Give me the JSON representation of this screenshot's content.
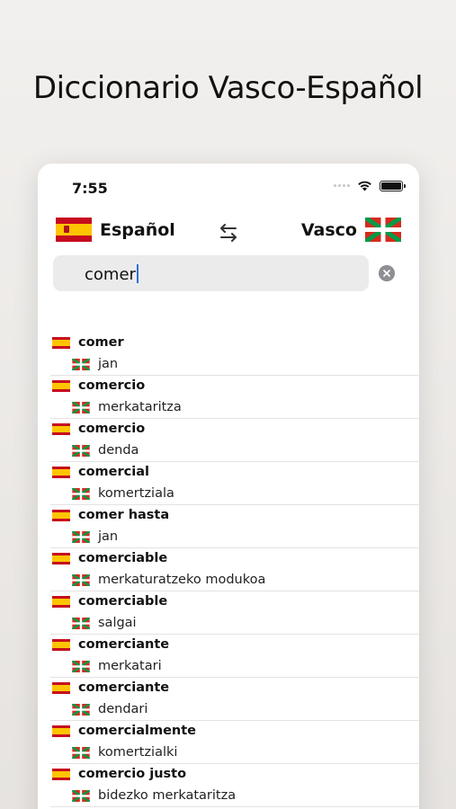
{
  "caption": "Diccionario Vasco-Español",
  "status_bar": {
    "time": "7:55"
  },
  "header": {
    "source_language": "Español",
    "target_language": "Vasco"
  },
  "search": {
    "value": "comer"
  },
  "results": [
    {
      "spanish": "comer",
      "basque": "jan"
    },
    {
      "spanish": "comercio",
      "basque": "merkataritza"
    },
    {
      "spanish": "comercio",
      "basque": "denda"
    },
    {
      "spanish": "comercial",
      "basque": "komertziala"
    },
    {
      "spanish": "comer hasta",
      "basque": "jan"
    },
    {
      "spanish": "comerciable",
      "basque": "merkaturatzeko modukoa"
    },
    {
      "spanish": "comerciable",
      "basque": "salgai"
    },
    {
      "spanish": "comerciante",
      "basque": "merkatari"
    },
    {
      "spanish": "comerciante",
      "basque": "dendari"
    },
    {
      "spanish": "comercialmente",
      "basque": "komertzialki"
    },
    {
      "spanish": "comercio justo",
      "basque": "bidezko merkataritza"
    }
  ],
  "colors": {
    "spain_red": "#c60b1e",
    "spain_yellow": "#ffc400",
    "ikurrina_red": "#d52b1e",
    "ikurrina_green": "#009b48",
    "caret_blue": "#2b6fe0"
  }
}
